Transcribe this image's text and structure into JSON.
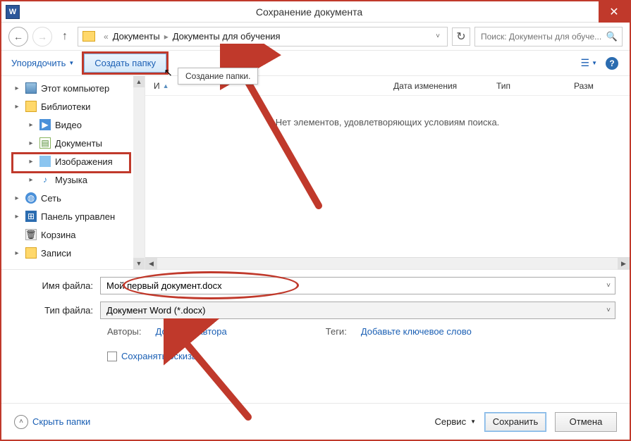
{
  "titlebar": {
    "title": "Сохранение документа"
  },
  "breadcrumb": {
    "prefix": "«",
    "seg1": "Документы",
    "seg2": "Документы для обучения"
  },
  "search": {
    "placeholder": "Поиск: Документы для обуче..."
  },
  "toolbar": {
    "organize": "Упорядочить",
    "new_folder": "Создать папку",
    "tooltip": "Создание папки."
  },
  "columns": {
    "name": "И",
    "date": "Дата изменения",
    "type": "Тип",
    "size": "Разм"
  },
  "empty": "Нет элементов, удовлетворяющих условиям поиска.",
  "tree": {
    "computer": "Этот компьютер",
    "libraries": "Библиотеки",
    "video": "Видео",
    "documents": "Документы",
    "images": "Изображения",
    "music": "Музыка",
    "network": "Сеть",
    "panel": "Панель управлен",
    "bin": "Корзина",
    "records": "Записи"
  },
  "form": {
    "filename_label": "Имя файла:",
    "filename_value": "Мой первый документ.docx",
    "filetype_label": "Тип файла:",
    "filetype_value": "Документ Word (*.docx)",
    "authors_label": "Авторы:",
    "authors_link": "Добавьте автора",
    "tags_label": "Теги:",
    "tags_link": "Добавьте ключевое слово",
    "thumbs": "Сохранять эскизы"
  },
  "footer": {
    "hide_folders": "Скрыть папки",
    "service": "Сервис",
    "save": "Сохранить",
    "cancel": "Отмена"
  }
}
